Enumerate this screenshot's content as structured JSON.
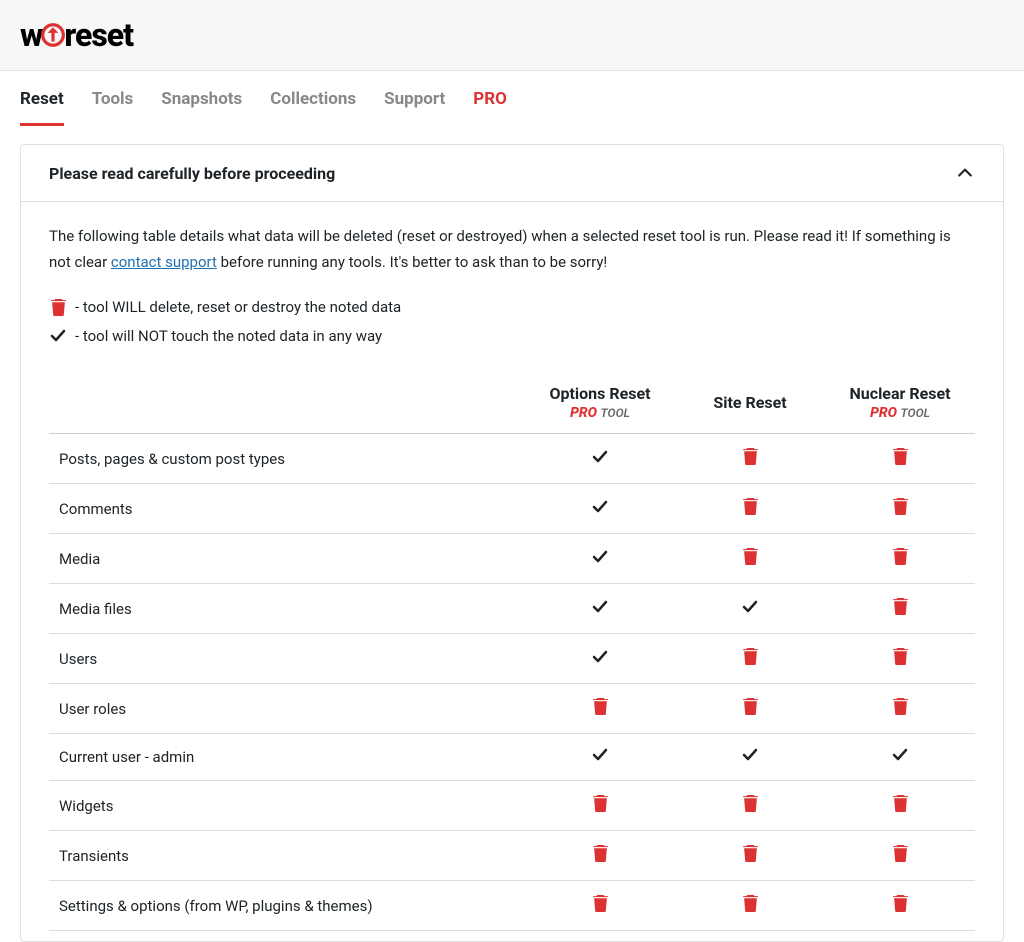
{
  "logo_alt": "wpreset",
  "tabs": {
    "reset": "Reset",
    "tools": "Tools",
    "snapshots": "Snapshots",
    "collections": "Collections",
    "support": "Support",
    "pro": "PRO"
  },
  "panel": {
    "title": "Please read carefully before proceeding",
    "intro_pre": "The following table details what data will be deleted (reset or destroyed) when a selected reset tool is run. Please read it! If something is not clear ",
    "contact_link": "contact support",
    "intro_post": " before running any tools. It's better to ask than to be sorry!",
    "legend_delete": "- tool WILL delete, reset or destroy the noted data",
    "legend_keep": "- tool will NOT touch the noted data in any way"
  },
  "table": {
    "columns": [
      {
        "label": "Options Reset",
        "pro": true
      },
      {
        "label": "Site Reset",
        "pro": false
      },
      {
        "label": "Nuclear Reset",
        "pro": true
      }
    ],
    "pro_word": "PRO",
    "tool_word": "TOOL",
    "rows": [
      {
        "label": "Posts, pages & custom post types",
        "cells": [
          "check",
          "trash",
          "trash"
        ]
      },
      {
        "label": "Comments",
        "cells": [
          "check",
          "trash",
          "trash"
        ]
      },
      {
        "label": "Media",
        "cells": [
          "check",
          "trash",
          "trash"
        ]
      },
      {
        "label": "Media files",
        "cells": [
          "check",
          "check",
          "trash"
        ]
      },
      {
        "label": "Users",
        "cells": [
          "check",
          "trash",
          "trash"
        ]
      },
      {
        "label": "User roles",
        "cells": [
          "trash",
          "trash",
          "trash"
        ]
      },
      {
        "label": "Current user - admin",
        "cells": [
          "check",
          "check",
          "check"
        ]
      },
      {
        "label": "Widgets",
        "cells": [
          "trash",
          "trash",
          "trash"
        ]
      },
      {
        "label": "Transients",
        "cells": [
          "trash",
          "trash",
          "trash"
        ]
      },
      {
        "label": "Settings & options (from WP, plugins & themes)",
        "cells": [
          "trash",
          "trash",
          "trash"
        ]
      }
    ]
  }
}
